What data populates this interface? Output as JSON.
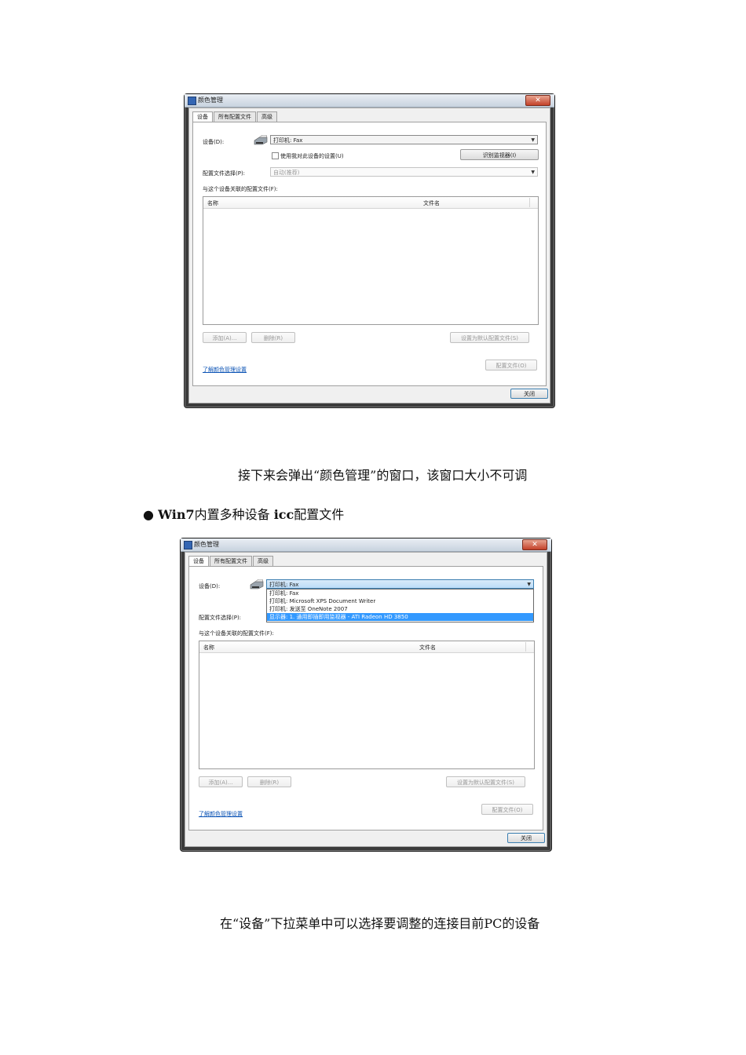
{
  "screenshot1": {
    "window_title": "颜色管理",
    "close_symbol": "✕",
    "tabs": [
      "设备",
      "所有配置文件",
      "高级"
    ],
    "device_label": "设备(D):",
    "device_value": "打印机: Fax",
    "checkbox_label": "使用我对此设备的设置(U)",
    "identify_button": "识别监视器(I)",
    "profile_select_label": "配置文件选择(P):",
    "profile_select_value": "自动(推荐)",
    "assoc_label": "与这个设备关联的配置文件(F):",
    "col_name": "名称",
    "col_file": "文件名",
    "add_button": "添加(A)...",
    "remove_button": "删除(R)",
    "set_default_button": "设置为默认配置文件(S)",
    "learn_link": "了解颜色管理设置",
    "profiles_button": "配置文件(O)",
    "close_button": "关闭"
  },
  "caption1": "接下来会弹出“颜色管理”的窗口，该窗口大小不可调",
  "bullet": {
    "symbol": "●",
    "bold": "Win7",
    "text": "内置多种设备",
    "bold2": "icc",
    "text2": "配置文件"
  },
  "screenshot2": {
    "window_title": "颜色管理",
    "close_symbol": "✕",
    "tabs": [
      "设备",
      "所有配置文件",
      "高级"
    ],
    "device_label": "设备(D):",
    "device_value": "打印机: Fax",
    "dropdown_items": [
      "打印机: Fax",
      "打印机: Microsoft XPS Document Writer",
      "打印机: 发送至 OneNote 2007",
      "显示器: 1. 通用即插即用监视器 - ATI Radeon HD 3850"
    ],
    "profile_select_label": "配置文件选择(P):",
    "assoc_label": "与这个设备关联的配置文件(F):",
    "col_name": "名称",
    "col_file": "文件名",
    "add_button": "添加(A)...",
    "remove_button": "删除(R)",
    "set_default_button": "设置为默认配置文件(S)",
    "learn_link": "了解颜色管理设置",
    "profiles_button": "配置文件(O)",
    "close_button": "关闭"
  },
  "caption2": "在“设备”下拉菜单中可以选择要调整的连接目前PC的设备"
}
